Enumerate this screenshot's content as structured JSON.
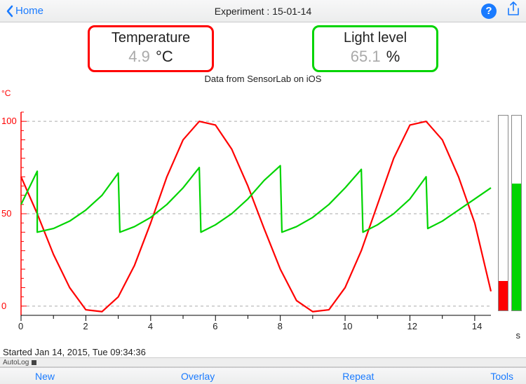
{
  "header": {
    "home_label": "Home",
    "title": "Experiment : 15-01-14"
  },
  "sensors": {
    "temperature": {
      "title": "Temperature",
      "value": "4.9",
      "unit": "°C"
    },
    "light": {
      "title": "Light level",
      "value": "65.1",
      "unit": "%"
    }
  },
  "subtitle": "Data from SensorLab on iOS",
  "chart_axes": {
    "y_label": "°C",
    "x_label": "s",
    "y_ticks": [
      "0",
      "50",
      "100"
    ],
    "x_ticks": [
      "0",
      "2",
      "4",
      "6",
      "8",
      "10",
      "12",
      "14"
    ]
  },
  "level_bars": {
    "red_pct": 15,
    "green_pct": 65
  },
  "started_text": "Started Jan 14, 2015, Tue 09:34:36",
  "autolog_label": "AutoLog",
  "toolbar": {
    "new": "New",
    "overlay": "Overlay",
    "repeat": "Repeat",
    "tools": "Tools"
  },
  "chart_data": {
    "type": "line",
    "title": "Data from SensorLab on iOS",
    "xlabel": "s",
    "ylabel": "°C",
    "xlim": [
      0,
      14.5
    ],
    "ylim": [
      -5,
      105
    ],
    "series": [
      {
        "name": "Temperature",
        "color": "#ff0000",
        "x": [
          0,
          0.5,
          1,
          1.5,
          2,
          2.5,
          3,
          3.5,
          4,
          4.5,
          5,
          5.5,
          6,
          6.5,
          7,
          7.5,
          8,
          8.5,
          9,
          9.5,
          10,
          10.5,
          11,
          11.5,
          12,
          12.5,
          13,
          13.5,
          14,
          14.5
        ],
        "values": [
          70,
          50,
          28,
          10,
          -2,
          -3,
          5,
          22,
          45,
          70,
          90,
          100,
          98,
          85,
          65,
          42,
          20,
          3,
          -3,
          -2,
          10,
          30,
          55,
          80,
          98,
          100,
          90,
          70,
          45,
          8
        ]
      },
      {
        "name": "Light level",
        "color": "#00d400",
        "x": [
          0,
          0.5,
          0.5001,
          1,
          1.5,
          2,
          2.5,
          3,
          3.05,
          3.5,
          4,
          4.5,
          5,
          5.5,
          5.55,
          6,
          6.5,
          7,
          7.5,
          8,
          8.05,
          8.5,
          9,
          9.5,
          10,
          10.5,
          10.55,
          11,
          11.5,
          12,
          12.5,
          12.55,
          13,
          13.5,
          14,
          14.5
        ],
        "values": [
          55,
          73,
          40,
          42,
          46,
          52,
          60,
          72,
          40,
          43,
          48,
          55,
          64,
          75,
          40,
          44,
          50,
          58,
          68,
          76,
          40,
          43,
          48,
          55,
          64,
          74,
          40,
          44,
          50,
          58,
          70,
          42,
          46,
          52,
          58,
          64
        ]
      }
    ]
  }
}
